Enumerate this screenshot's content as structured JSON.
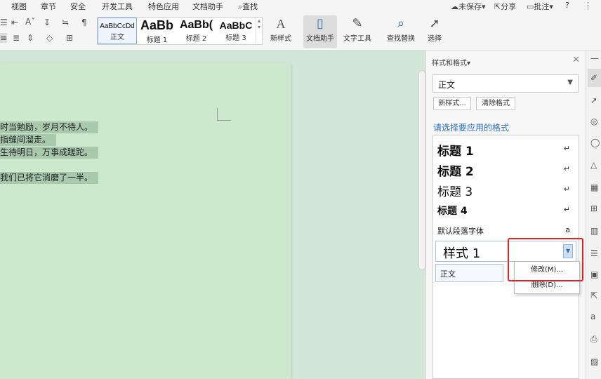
{
  "menubar": {
    "items": [
      "视图",
      "章节",
      "安全",
      "开发工具",
      "特色应用",
      "文档助手",
      "查找"
    ],
    "unsaved": "未保存",
    "share": "分享",
    "comment": "批注",
    "help": "?",
    "more": "⋮"
  },
  "ribbon": {
    "gallery": [
      {
        "sample": "AaBbCcDd",
        "label": "正文"
      },
      {
        "sample": "AaBb",
        "label": "标题 1"
      },
      {
        "sample": "AaBb(",
        "label": "标题 2"
      },
      {
        "sample": "AaBbC",
        "label": "标题 3"
      }
    ],
    "buttons": {
      "new_style": "新样式",
      "doc_assistant": "文档助手",
      "text_tools": "文字工具",
      "find_replace": "查找替换",
      "select": "选择"
    }
  },
  "document": {
    "lines": [
      "时当勉励，岁月不待人。",
      "指缝间溜走。",
      "生待明日，万事成蹉跎。",
      "我们已将它消磨了一半。"
    ]
  },
  "styles_panel": {
    "title": "样式和格式",
    "current_style": "正文",
    "new_style_btn": "新样式...",
    "clear_format_btn": "清除格式",
    "choose_label": "请选择要应用的格式",
    "styles": [
      {
        "name": "标题  1",
        "mark": "↵"
      },
      {
        "name": "标题  2",
        "mark": "↵"
      },
      {
        "name": "标题  3",
        "mark": "↵"
      },
      {
        "name": "标题  4",
        "mark": "↵"
      },
      {
        "name": "默认段落字体",
        "mark": "a"
      }
    ],
    "style1": "样式 1",
    "zhengwen": "正文",
    "context_menu": {
      "modify": "修改(M)...",
      "delete": "删除(D)..."
    }
  }
}
